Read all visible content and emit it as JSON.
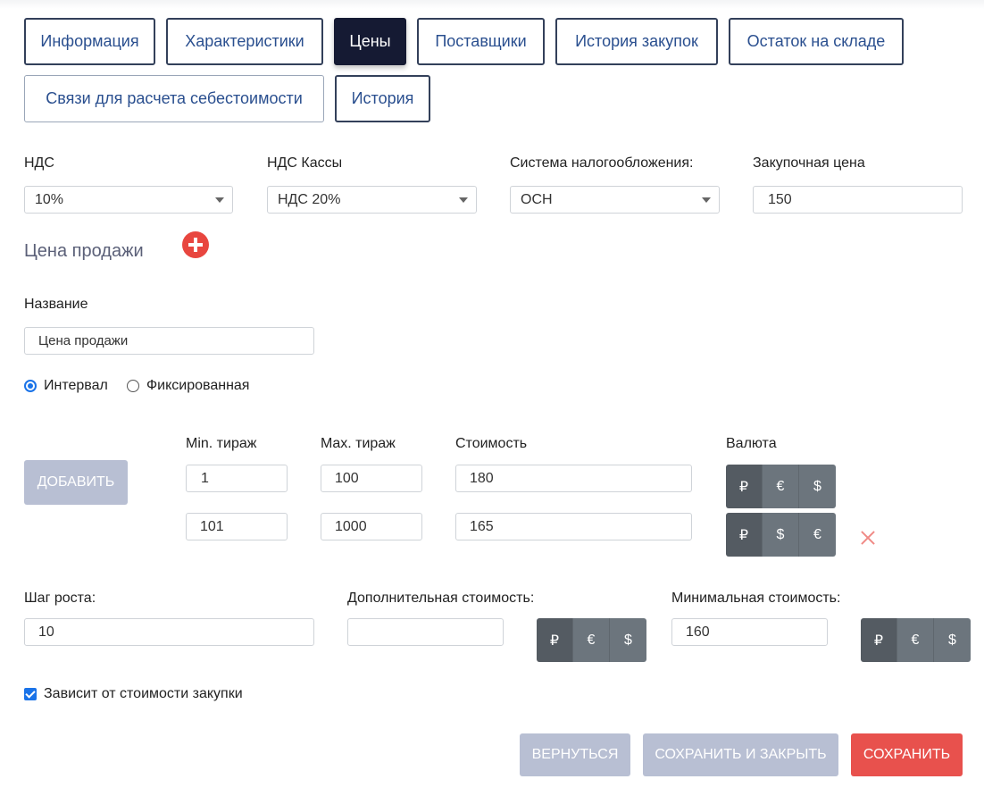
{
  "tabs": [
    {
      "label": "Информация"
    },
    {
      "label": "Характеристики"
    },
    {
      "label": "Цены"
    },
    {
      "label": "Поставщики"
    },
    {
      "label": "История закупок"
    },
    {
      "label": "Остаток на складе"
    },
    {
      "label": "Связи для расчета себестоимости"
    },
    {
      "label": "История"
    }
  ],
  "active_tab": "Цены",
  "taxes": {
    "vat": {
      "label": "НДС",
      "value": "10%"
    },
    "cash_vat": {
      "label": "НДС Кассы",
      "value": "НДС 20%"
    },
    "tax_system": {
      "label": "Система налогообложения:",
      "value": "ОСН"
    },
    "purchase_price": {
      "label": "Закупочная цена",
      "value": "150"
    }
  },
  "sale_price": {
    "title": "Цена продажи",
    "name_label": "Название",
    "name_value": "Цена продажи",
    "price_mode": {
      "options": [
        "Интервал",
        "Фиксированная"
      ],
      "selected": "Интервал"
    },
    "add_label": "Добавить",
    "headers": {
      "min": "Min. тираж",
      "max": "Max. тираж",
      "cost": "Стоимость",
      "currency": "Валюта"
    },
    "rows": [
      {
        "min": "1",
        "max": "100",
        "cost": "180",
        "currencies": [
          "₽",
          "€",
          "$"
        ],
        "selected": "₽"
      },
      {
        "min": "101",
        "max": "1000",
        "cost": "165",
        "currencies": [
          "₽",
          "$",
          "€"
        ],
        "selected": "₽"
      }
    ]
  },
  "extras": {
    "step_label": "Шаг роста:",
    "step_value": "10",
    "additional_label": "Дополнительная стоимость:",
    "additional_value": "",
    "additional_currencies": [
      "₽",
      "€",
      "$"
    ],
    "minimum_label": "Минимальная стоимость:",
    "minimum_value": "160",
    "minimum_currencies": [
      "₽",
      "€",
      "$"
    ]
  },
  "depends_on_purchase": {
    "label": "Зависит от стоимости закупки",
    "checked": true
  },
  "actions": {
    "back": "Вернуться",
    "save_close": "Сохранить и закрыть",
    "save": "Сохранить"
  },
  "colors": {
    "accent": "#e8514d",
    "tab_active": "#151a33",
    "muted_button": "#b8bfd3",
    "currency_button": "#6c757d"
  }
}
